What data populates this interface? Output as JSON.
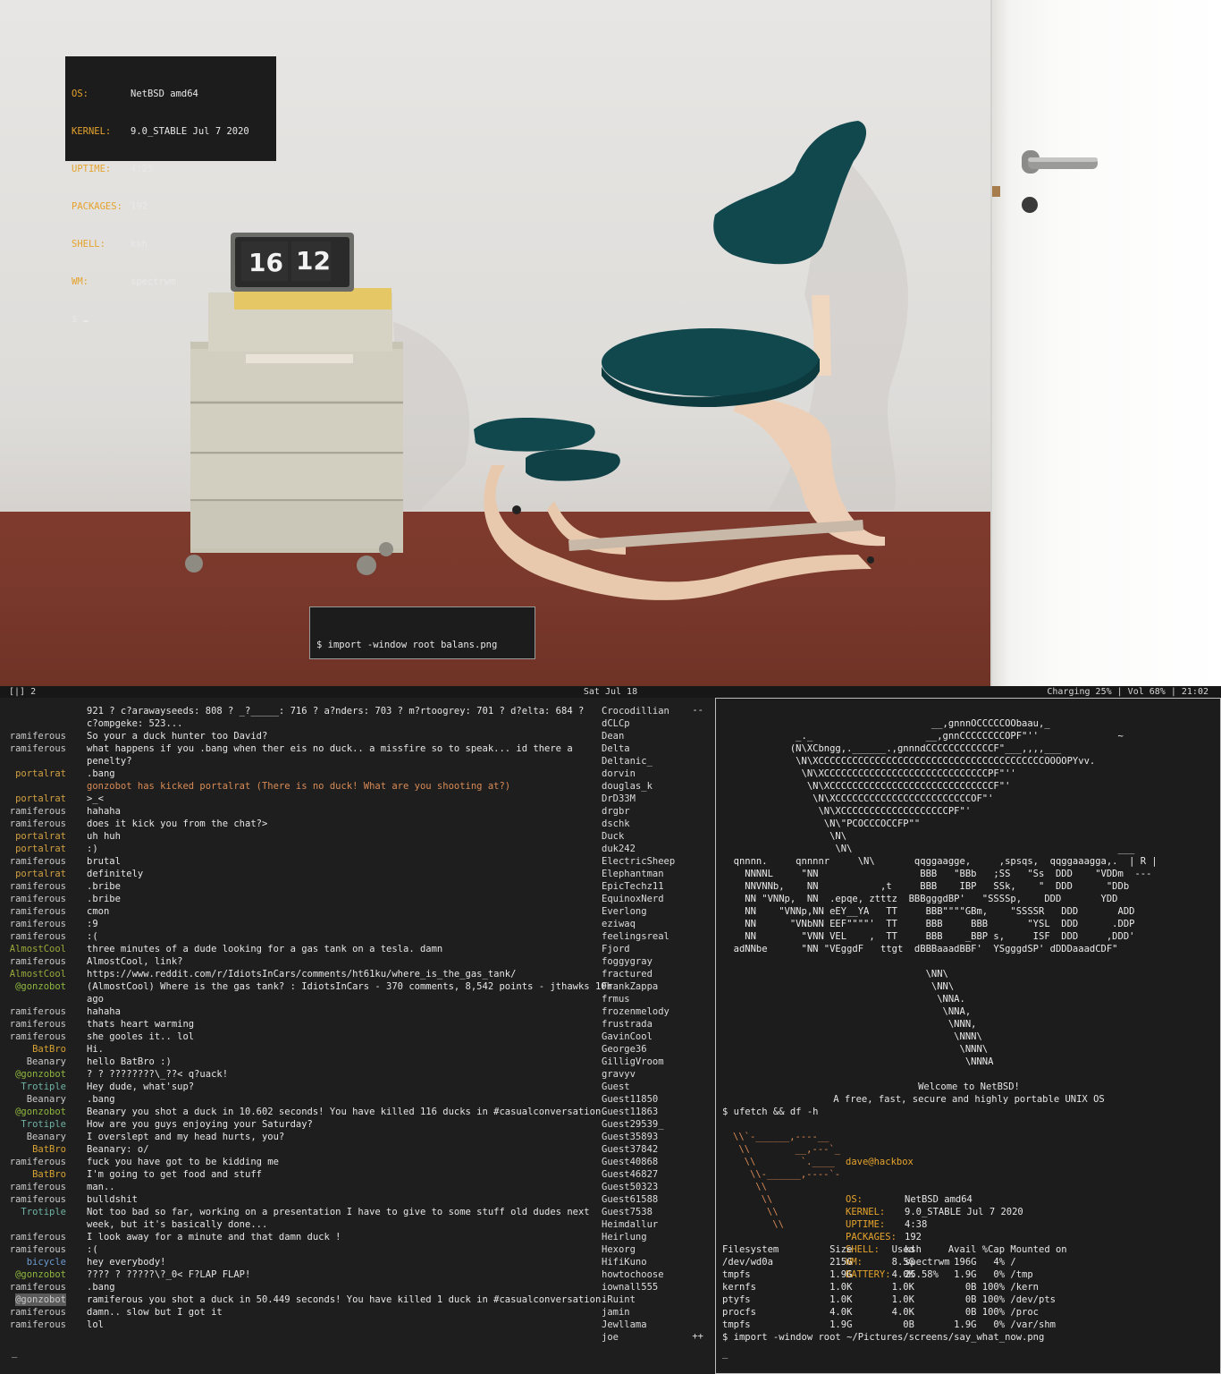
{
  "floating_info": {
    "rows": [
      {
        "k": "OS:",
        "v": "NetBSD amd64"
      },
      {
        "k": "KERNEL:",
        "v": "9.0_STABLE Jul 7 2020"
      },
      {
        "k": "UPTIME:",
        "v": "4:25"
      },
      {
        "k": "PACKAGES:",
        "v": "192"
      },
      {
        "k": "SHELL:",
        "v": "ksh"
      },
      {
        "k": "WM:",
        "v": "spectrwm"
      }
    ],
    "prompt": "$"
  },
  "floating_import": {
    "command": "$ import -window root balans.png"
  },
  "clock_display": {
    "hours": "16",
    "minutes": "12"
  },
  "statusbar": {
    "workspace": "[|] 2",
    "date": "Sat Jul 18",
    "status": "Charging 25% | Vol 68% | 21:02"
  },
  "irc": {
    "messages": [
      {
        "nick": "",
        "c": "",
        "text": "921 ? c?arawayseeds: 808 ? _?_____: 716 ? a?nders: 703 ? m?rtoogrey: 701 ? d?elta: 684 ?"
      },
      {
        "nick": "",
        "c": "",
        "text": "c?ompgeke: 523..."
      },
      {
        "nick": "ramiferous",
        "c": "n-rami",
        "text": "So your a duck hunter too David?"
      },
      {
        "nick": "ramiferous",
        "c": "n-rami",
        "text": "what happens if you .bang when ther eis no duck.. a missfire so to speak... id there a"
      },
      {
        "nick": "",
        "c": "",
        "text": "penelty?"
      },
      {
        "nick": "portalrat",
        "c": "n-port",
        "text": ".bang"
      },
      {
        "nick": "",
        "c": "",
        "kick": true,
        "text": "gonzobot has kicked portalrat (There is no duck! What are you shooting at?)"
      },
      {
        "nick": "portalrat",
        "c": "n-port",
        "text": ">_<"
      },
      {
        "nick": "ramiferous",
        "c": "n-rami",
        "text": "hahaha"
      },
      {
        "nick": "ramiferous",
        "c": "n-rami",
        "text": "does it kick you from the chat?>"
      },
      {
        "nick": "portalrat",
        "c": "n-port",
        "text": "uh huh"
      },
      {
        "nick": "portalrat",
        "c": "n-port",
        "text": ":)"
      },
      {
        "nick": "ramiferous",
        "c": "n-rami",
        "text": "brutal"
      },
      {
        "nick": "portalrat",
        "c": "n-port",
        "text": "definitely"
      },
      {
        "nick": "ramiferous",
        "c": "n-rami",
        "text": ".bribe"
      },
      {
        "nick": "ramiferous",
        "c": "n-rami",
        "text": ".bribe"
      },
      {
        "nick": "ramiferous",
        "c": "n-rami",
        "text": "cmon"
      },
      {
        "nick": "ramiferous",
        "c": "n-rami",
        "text": ":9"
      },
      {
        "nick": "ramiferous",
        "c": "n-rami",
        "text": ":("
      },
      {
        "nick": "AlmostCool",
        "c": "n-ac",
        "text": "three minutes of a dude looking for a gas tank on a tesla. damn"
      },
      {
        "nick": "ramiferous",
        "c": "n-rami",
        "text": "AlmostCool, link?"
      },
      {
        "nick": "AlmostCool",
        "c": "n-ac",
        "text": "https://www.reddit.com/r/IdiotsInCars/comments/ht61ku/where_is_the_gas_tank/"
      },
      {
        "nick": "@gonzobot",
        "c": "n-bot",
        "link": true,
        "text": "(AlmostCool) Where is the gas tank? : IdiotsInCars - 370 comments, 8,542 points - jthawks 10h"
      },
      {
        "nick": "",
        "c": "",
        "text": "ago"
      },
      {
        "nick": "ramiferous",
        "c": "n-rami",
        "text": "hahaha"
      },
      {
        "nick": "ramiferous",
        "c": "n-rami",
        "text": "thats heart warming"
      },
      {
        "nick": "ramiferous",
        "c": "n-rami",
        "text": "she gooles it.. lol"
      },
      {
        "nick": "BatBro",
        "c": "n-bat",
        "text": "Hi."
      },
      {
        "nick": "Beanary",
        "c": "n-bea",
        "text": "hello BatBro :)"
      },
      {
        "nick": "@gonzobot",
        "c": "n-bot",
        "text": "? ? ????????\\_??< q?uack!"
      },
      {
        "nick": "Trotiple",
        "c": "n-tro",
        "text": "Hey dude, what'sup?"
      },
      {
        "nick": "Beanary",
        "c": "n-bea",
        "text": ".bang"
      },
      {
        "nick": "@gonzobot",
        "c": "n-bot",
        "text": "Beanary you shot a duck in 10.602 seconds! You have killed 116 ducks in #casualconversation."
      },
      {
        "nick": "Trotiple",
        "c": "n-tro",
        "text": "How are you guys enjoying your Saturday?"
      },
      {
        "nick": "Beanary",
        "c": "n-bea",
        "text": "I overslept and my head hurts, you?"
      },
      {
        "nick": "BatBro",
        "c": "n-bat",
        "text": "Beanary: o/"
      },
      {
        "nick": "ramiferous",
        "c": "n-rami",
        "text": "fuck you have got to be kidding me"
      },
      {
        "nick": "BatBro",
        "c": "n-bat",
        "text": "I'm going to get food and stuff"
      },
      {
        "nick": "ramiferous",
        "c": "n-rami",
        "text": "man.."
      },
      {
        "nick": "ramiferous",
        "c": "n-rami",
        "text": "bulldshit"
      },
      {
        "nick": "Trotiple",
        "c": "n-tro",
        "text": "Not too bad so far, working on a presentation I have to give to some stuff old dudes next"
      },
      {
        "nick": "",
        "c": "",
        "text": "week, but it's basically done..."
      },
      {
        "nick": "ramiferous",
        "c": "n-rami",
        "text": "I look away for a minute and that damn duck !"
      },
      {
        "nick": "ramiferous",
        "c": "n-rami",
        "text": ":("
      },
      {
        "nick": "bicycle",
        "c": "n-bic",
        "text": "hey everybody!"
      },
      {
        "nick": "@gonzobot",
        "c": "n-bot",
        "text": "???? ? ?????\\?_0< F?LAP FLAP!"
      },
      {
        "nick": "ramiferous",
        "c": "n-rami",
        "text": ".bang"
      },
      {
        "nick": "@gonzobot",
        "c": "n-sel",
        "text": "ramiferous you shot a duck in 50.449 seconds! You have killed 1 duck in #casualconversation."
      },
      {
        "nick": "ramiferous",
        "c": "n-rami",
        "text": "damn.. slow but I got it"
      },
      {
        "nick": "ramiferous",
        "c": "n-rami",
        "text": "lol"
      }
    ],
    "users": [
      "Crocodillian",
      "dCLCp",
      "Dean",
      "Delta",
      "Deltanic_",
      "dorvin",
      "douglas_k",
      "DrD33M",
      "drgbr",
      "dschk",
      "Duck",
      "duk242",
      "ElectricSheep",
      "Elephantman",
      "EpicTechz11",
      "EquinoxNerd",
      "Everlong",
      "eziwaq",
      "feelingsreal",
      "Fjord",
      "foggygray",
      "fractured",
      "FrankZappa",
      "frmus",
      "frozenmelody",
      "frustrada",
      "GavinCool",
      "George36",
      "GilligVroom",
      "gravyv",
      "Guest",
      "Guest11850",
      "Guest11863",
      "Guest29539_",
      "Guest35893",
      "Guest37842",
      "Guest40868",
      "Guest46827",
      "Guest50323",
      "Guest61588",
      "Guest7538",
      "Heimdallur",
      "Heirlung",
      "Hexorg",
      "HifiKuno",
      "howtochoose",
      "iownall555",
      "iRuint",
      "jamin",
      "Jewllama",
      "joe"
    ],
    "scroll_top": "--",
    "scroll_bottom": "++",
    "prompt": "_"
  },
  "shell": {
    "ascii_logo": "                                     __,gnnnOCCCCCOObaau,_\n             _._                    __,gnnCCCCCCCCOPF\"''              ~\n            (N\\XCbngg,.______.,gnnndCCCCCCCCCCCCF\"___,,,,___\n             \\N\\XCCCCCCCCCCCCCCCCCCCCCCCCCCCCCCCCCCCCCCCCOOOOPYvv.\n              \\N\\XCCCCCCCCCCCCCCCCCCCCCCCCCCCCCPF\"''\n               \\N\\XCCCCCCCCCCCCCCCCCCCCCCCCCCCCCF\"'\n                \\N\\XCCCCCCCCCCCCCCCCCCCCCCCCOF\"'\n                 \\N\\XCCCCCCCCCCCCCCCCCCCPF\"'\n                  \\N\\\"PCOCCCOCCFP\"\"\n                   \\N\\\n                    \\N\\                                               ___\n  qnnnn.     qnnnnr     \\N\\       qqggaagge,     ,spsqs,  qqggaaagga,.  | R |\n    NNNNL     \"NN                  BBB   \"BBb   ;SS   \"Ss  DDD    \"VDDm  ---\n    NNVNNb,    NN           ,t     BBB    IBP   SSk,    \"  DDD      \"DDb\n    NN \"VNNp,  NN  .epqe, ztttz  BBBgggdBP'   \"SSSSp,    DDD       YDD\n    NN    \"VNNp,NN eEY__YA   TT     BBB\"\"\"\"GBm,    \"SSSSR   DDD       ADD\n    NN      \"VNbNN EEF\"\"\"\"'  TT     BBB     BBB       \"YSL  DDD      .DDP\n    NN        \"VNN VEL    ,  TT     BBB    _BBP s,     ISF  DDD     ,DDD'\n  adNNbe      \"NN \"VEggdF   ttgt  dBBBaaadBBF'  YSgggdSP' dDDDaaadCDF\"\n\n                                    \\NN\\\n                                     \\NN\\\n                                      \\NNA.\n                                       \\NNA,\n                                        \\NNN,\n                                         \\NNN\\\n                                          \\NNN\\\n                                           \\NNNA",
    "welcome": "Welcome to NetBSD!",
    "tagline": "A free, fast, secure and highly portable UNIX OS",
    "cmd1": "$ ufetch && df -h",
    "ufetch_art": "\\\\`-______,----__\n \\\\        __,---`_\n  \\\\        `.____\n   \\\\-______,----`-\n    \\\\\n     \\\\\n      \\\\\n       \\\\",
    "user": "dave@hackbox",
    "ufetch": [
      {
        "k": "OS:",
        "v": "NetBSD amd64"
      },
      {
        "k": "KERNEL:",
        "v": "9.0_STABLE Jul 7 2020"
      },
      {
        "k": "UPTIME:",
        "v": "4:38"
      },
      {
        "k": "PACKAGES:",
        "v": "192"
      },
      {
        "k": "SHELL:",
        "v": "ksh"
      },
      {
        "k": "WM:",
        "v": "spectrwm"
      },
      {
        "k": "BATTERY:",
        "v": "25.58%"
      }
    ],
    "df": [
      "Filesystem         Size       Used      Avail %Cap Mounted on",
      "/dev/wd0a          215G       8.5G       196G   4% /",
      "tmpfs              1.9G       4.0K       1.9G   0% /tmp",
      "kernfs             1.0K       1.0K         0B 100% /kern",
      "ptyfs              1.0K       1.0K         0B 100% /dev/pts",
      "procfs             4.0K       4.0K         0B 100% /proc",
      "tmpfs              1.9G         0B       1.9G   0% /var/shm"
    ],
    "cmd2": "$ import -window root ~/Pictures/screens/say_what_now.png",
    "prompt": "_"
  }
}
